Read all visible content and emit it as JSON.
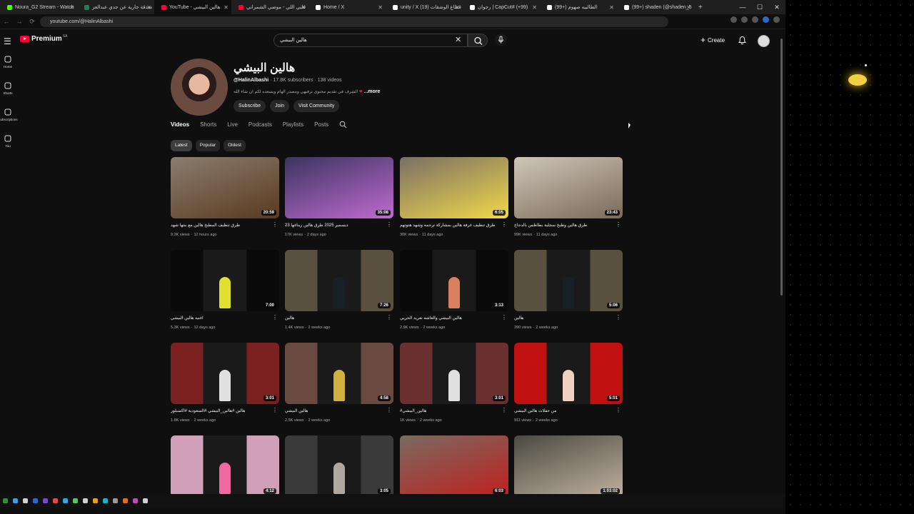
{
  "browser": {
    "tabs": [
      {
        "title": "Noura_G2 Stream - Watch",
        "color": "#53fc18"
      },
      {
        "title": "صدقة جارية عن جدي عبدالعز",
        "color": "#2a7a5a"
      },
      {
        "title": "YouTube - هالين البيشي",
        "color": "#ff0033"
      },
      {
        "title": "قلبي اللي - موضي الشمراني",
        "color": "#ff0033"
      },
      {
        "title": "Home / X",
        "color": "#ffffff"
      },
      {
        "title": "unity / X (19) قطاع الوشقات",
        "color": "#ffffff"
      },
      {
        "title": "رجوان | CapCut# (+99)",
        "color": "#ffffff"
      },
      {
        "title": "الطالبيه صهوم (+99)",
        "color": "#ffffff"
      },
      {
        "title": "(99+) shaden (@shaden_5",
        "color": "#ffffff"
      }
    ],
    "new_tab": "+",
    "window_controls": [
      "—",
      "☐",
      "✕"
    ],
    "url": "youtube.com/@HalinAlbashi",
    "nav": [
      "←",
      "→",
      "⟳"
    ]
  },
  "header": {
    "logo_word": "Premium",
    "logo_country": "SA",
    "search_value": "هالين البيشي",
    "create_label": "Create"
  },
  "guide": [
    {
      "label": "Home",
      "icon": "home-icon"
    },
    {
      "label": "Shorts",
      "icon": "shorts-icon"
    },
    {
      "label": "Subscriptions",
      "icon": "subscriptions-icon"
    },
    {
      "label": "You",
      "icon": "you-icon"
    }
  ],
  "channel": {
    "name": "هالين البيشي",
    "handle": "@HalinAlbashi",
    "subscribers": "17.8K subscribers",
    "videos": "138 videos",
    "separator": "·",
    "description": "الشرف في تقديم محتوى ترفيهي ومصدر الهام ويسعده لكم ان شاء الله",
    "more": "...more",
    "buttons": {
      "subscribe": "Subscribe",
      "join": "Join",
      "community": "Visit Community"
    }
  },
  "tabs": [
    "Videos",
    "Shorts",
    "Live",
    "Podcasts",
    "Playlists",
    "Posts"
  ],
  "chips": [
    "Latest",
    "Popular",
    "Oldest"
  ],
  "videos": [
    {
      "title": "طرق تنظيف المطبخ هالين مع بنتها شهد",
      "views": "9.2K views",
      "age": "12 hours ago",
      "duration": "20:59",
      "bg": "#8a7d6e",
      "accent": "#5a3a1e",
      "short": false
    },
    {
      "title": "ديسمبر 2025 طرق هالين ريناغها 23",
      "views": "17K views",
      "age": "2 days ago",
      "duration": "35:08",
      "bg": "#3a3560",
      "accent": "#c06ad0",
      "short": false
    },
    {
      "title": "طرق تنظيف غرفة هالين بمشاركة ترجمه وشهد هتوتهم",
      "views": "30K views",
      "age": "11 days ago",
      "duration": "6:05",
      "bg": "#7a6f66",
      "accent": "#f0d84a",
      "short": false
    },
    {
      "title": "طرق هالين وطبخ سجلية بطاطس بالدجاج",
      "views": "99K views",
      "age": "11 days ago",
      "duration": "23:43",
      "bg": "#cfc6b8",
      "accent": "#7a6a5a",
      "short": false
    },
    {
      "title": "اغنيه هالين البيشي",
      "views": "5.3K views",
      "age": "12 days ago",
      "duration": "7:00",
      "bg": "#0a0a0a",
      "accent": "#e0e030",
      "short": true
    },
    {
      "title": "هالين",
      "views": "1.4K views",
      "age": "2 weeks ago",
      "duration": "7:26",
      "bg": "#5a5040",
      "accent": "#1a2028",
      "short": true
    },
    {
      "title": "هالين البيشي والعاشه تعريد الحريي",
      "views": "2.9K views",
      "age": "2 weeks ago",
      "duration": "3:13",
      "bg": "#0a0a0a",
      "accent": "#d88060",
      "short": true
    },
    {
      "title": "هالين",
      "views": "390 views",
      "age": "2 weeks ago",
      "duration": "5:06",
      "bg": "#5a5040",
      "accent": "#1a2028",
      "short": true
    },
    {
      "title": "هالين #هالين_البيشي #السعودية #اكسبلور",
      "views": "1.8K views",
      "age": "2 weeks ago",
      "duration": "3:01",
      "bg": "#7a2020",
      "accent": "#e0e0e0",
      "short": true
    },
    {
      "title": "هالين البيشي",
      "views": "2.5K views",
      "age": "2 weeks ago",
      "duration": "4:58",
      "bg": "#6a4a40",
      "accent": "#d0b040",
      "short": true
    },
    {
      "title": "هالين_البيشي#",
      "views": "1K views",
      "age": "2 weeks ago",
      "duration": "3:01",
      "bg": "#6a3030",
      "accent": "#e0e0e0",
      "short": true
    },
    {
      "title": "من حفلات هالين البيشي",
      "views": "911 views",
      "age": "2 weeks ago",
      "duration": "5:01",
      "bg": "#c01010",
      "accent": "#f0d0c0",
      "short": true
    },
    {
      "title": "",
      "views": "",
      "age": "",
      "duration": "4:12",
      "bg": "#d0a0b8",
      "accent": "#f06aa0",
      "short": true
    },
    {
      "title": "",
      "views": "",
      "age": "",
      "duration": "3:05",
      "bg": "#3a3a3a",
      "accent": "#b0a8a0",
      "short": true
    },
    {
      "title": "",
      "views": "",
      "age": "",
      "duration": "6:03",
      "bg": "#7a6a60",
      "accent": "#c02020",
      "short": false
    },
    {
      "title": "",
      "views": "",
      "age": "",
      "duration": "1:03:02",
      "bg": "#4a4a40",
      "accent": "#c0b0a0",
      "short": false
    }
  ],
  "colors": {
    "accent": "#ff0033",
    "background": "#0f0f0f",
    "chip": "#272727"
  }
}
